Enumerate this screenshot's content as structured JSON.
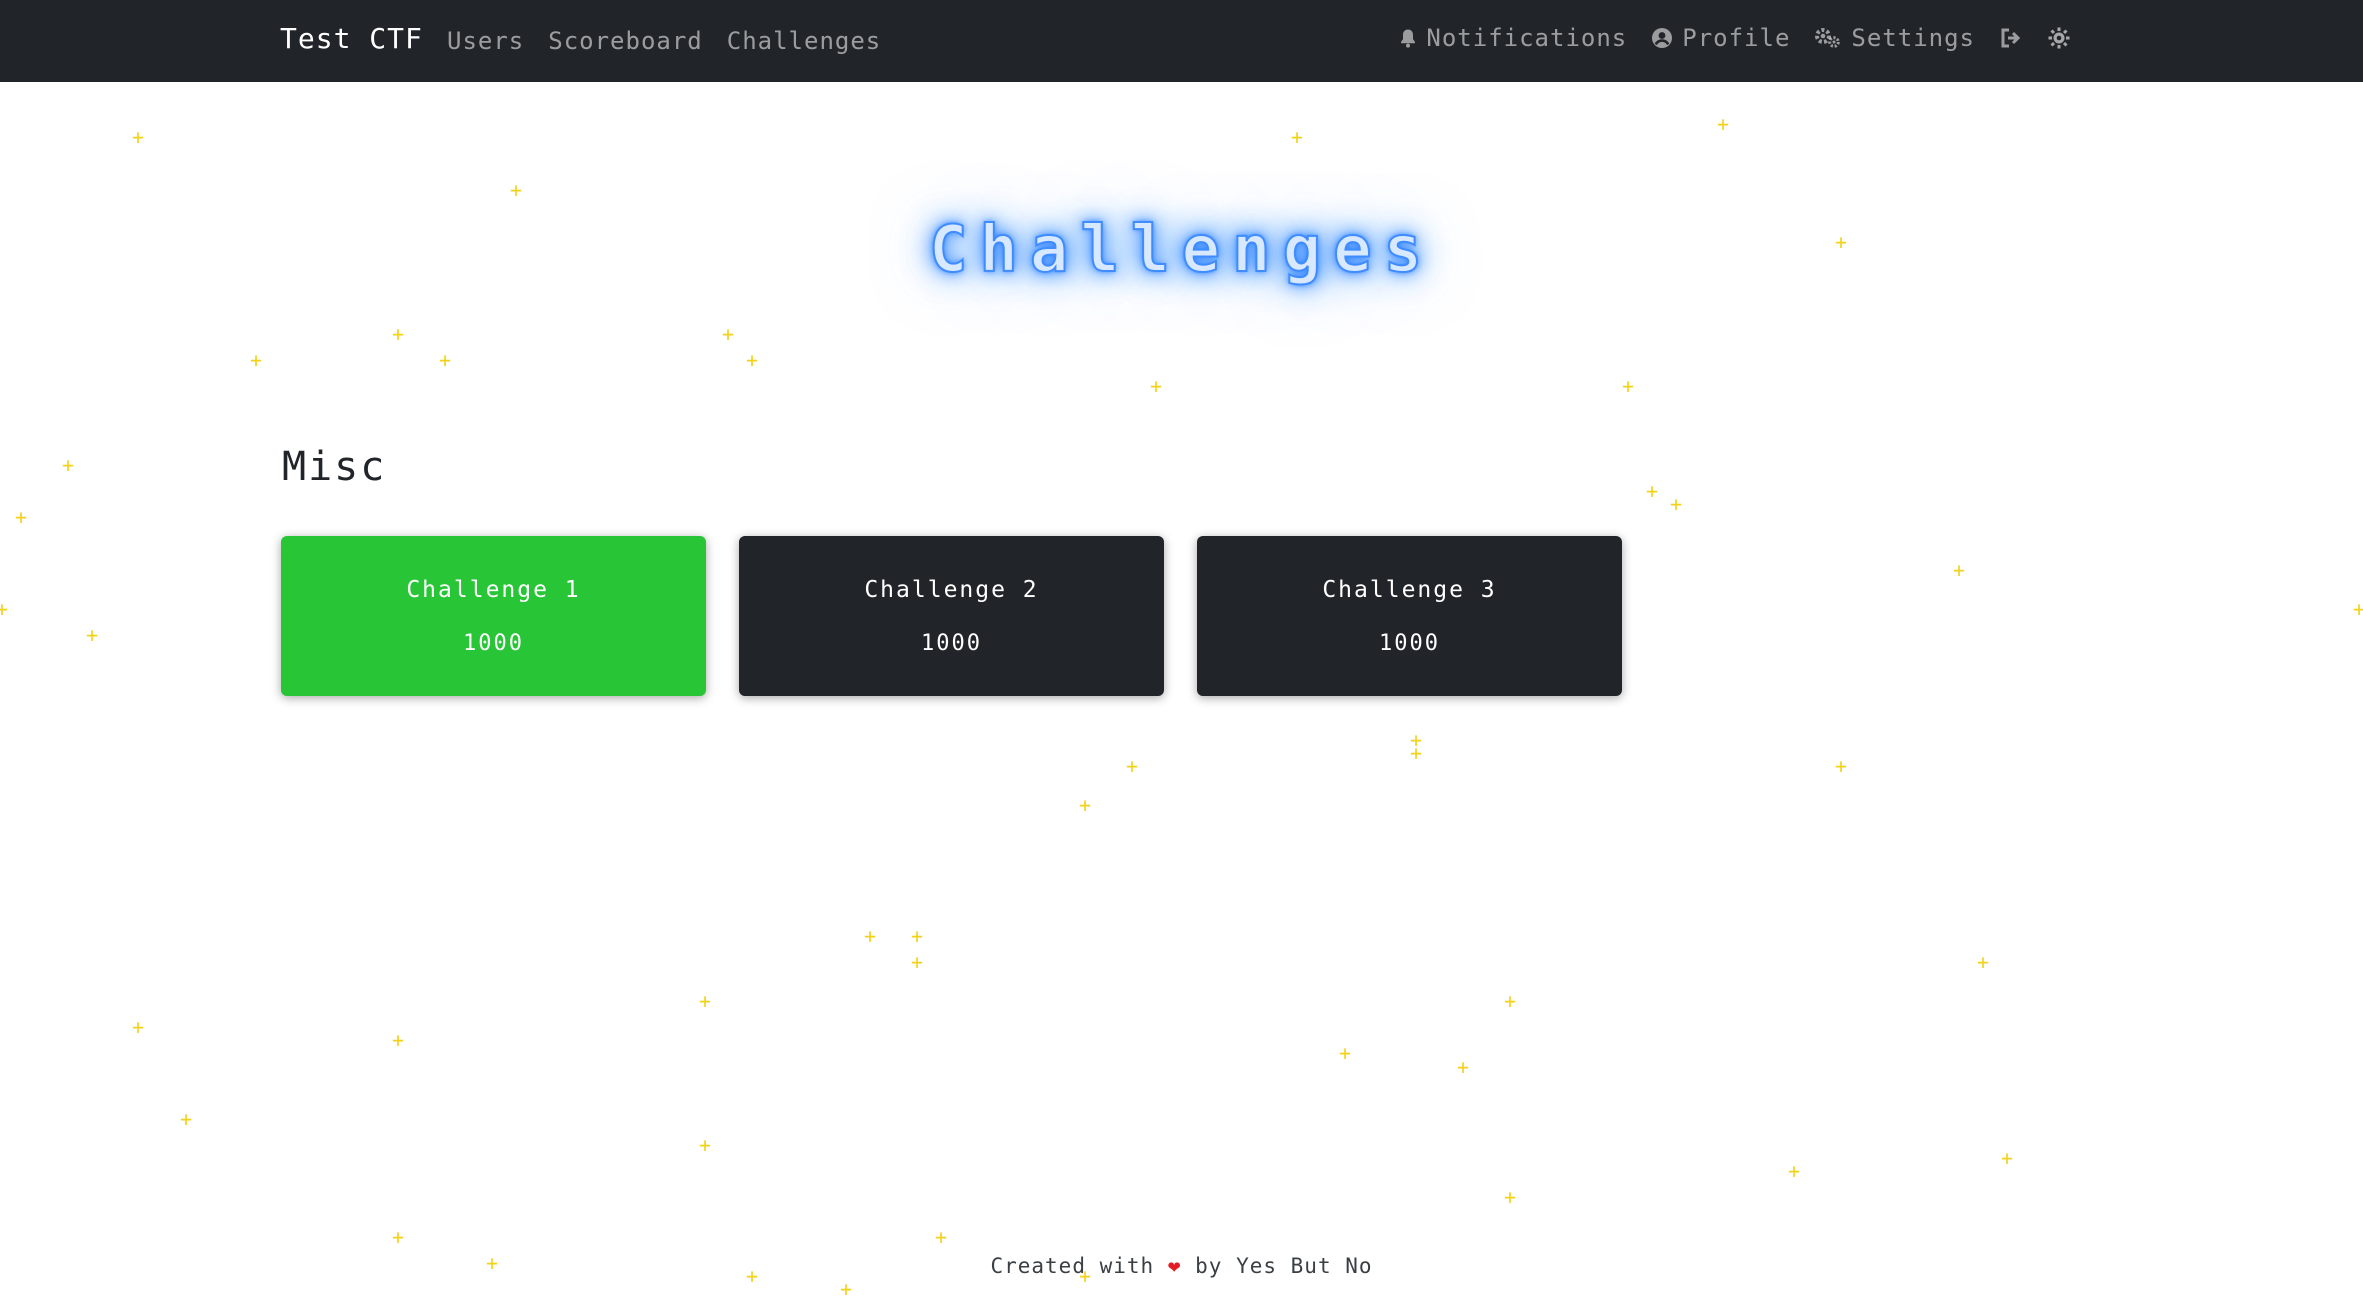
{
  "navbar": {
    "brand": "Test CTF",
    "links": [
      "Users",
      "Scoreboard",
      "Challenges"
    ],
    "right": {
      "notifications": "Notifications",
      "profile": "Profile",
      "settings": "Settings"
    }
  },
  "page": {
    "title": "Challenges"
  },
  "category": {
    "name": "Misc",
    "challenges": [
      {
        "name": "Challenge 1",
        "value": "1000",
        "solved": true
      },
      {
        "name": "Challenge 2",
        "value": "1000",
        "solved": false
      },
      {
        "name": "Challenge 3",
        "value": "1000",
        "solved": false
      }
    ]
  },
  "footer": {
    "prefix": "Created with",
    "suffix": "by Yes But No"
  },
  "colors": {
    "navbar_bg": "#212529",
    "solved": "#28c637",
    "unsolved": "#212529",
    "star": "#f2d21b",
    "title_glow": "#3a8cff",
    "heart": "#e31b23"
  },
  "icons": [
    "bell-icon",
    "user-circle-icon",
    "cogs-icon",
    "sign-out-icon",
    "theme-toggle-icon",
    "heart-icon",
    "star-decoration"
  ]
}
